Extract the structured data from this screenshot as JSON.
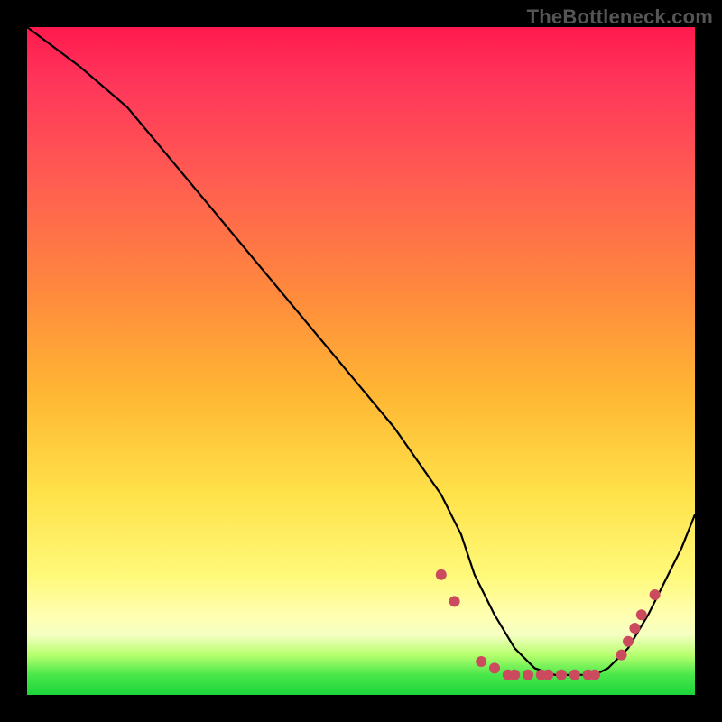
{
  "watermark": "TheBottleneck.com",
  "colors": {
    "dot": "#cc4a5e",
    "curve": "#000000",
    "frame_bg": "#000000"
  },
  "chart_data": {
    "type": "line",
    "title": "",
    "xlabel": "",
    "ylabel": "",
    "xlim": [
      0,
      100
    ],
    "ylim": [
      0,
      100
    ],
    "grid": false,
    "legend": false,
    "series": [
      {
        "name": "curve",
        "x": [
          0,
          8,
          15,
          25,
          35,
          45,
          55,
          62,
          65,
          67,
          70,
          73,
          76,
          79,
          82,
          85,
          87,
          90,
          93,
          95,
          98,
          100
        ],
        "y": [
          100,
          94,
          88,
          76,
          64,
          52,
          40,
          30,
          24,
          18,
          12,
          7,
          4,
          3,
          3,
          3,
          4,
          7,
          12,
          16,
          22,
          27
        ]
      }
    ],
    "points": [
      {
        "x": 62,
        "y": 18
      },
      {
        "x": 64,
        "y": 14
      },
      {
        "x": 68,
        "y": 5
      },
      {
        "x": 70,
        "y": 4
      },
      {
        "x": 72,
        "y": 3
      },
      {
        "x": 73,
        "y": 3
      },
      {
        "x": 75,
        "y": 3
      },
      {
        "x": 77,
        "y": 3
      },
      {
        "x": 78,
        "y": 3
      },
      {
        "x": 80,
        "y": 3
      },
      {
        "x": 82,
        "y": 3
      },
      {
        "x": 84,
        "y": 3
      },
      {
        "x": 85,
        "y": 3
      },
      {
        "x": 89,
        "y": 6
      },
      {
        "x": 90,
        "y": 8
      },
      {
        "x": 91,
        "y": 10
      },
      {
        "x": 92,
        "y": 12
      },
      {
        "x": 94,
        "y": 15
      }
    ],
    "annotations": []
  }
}
